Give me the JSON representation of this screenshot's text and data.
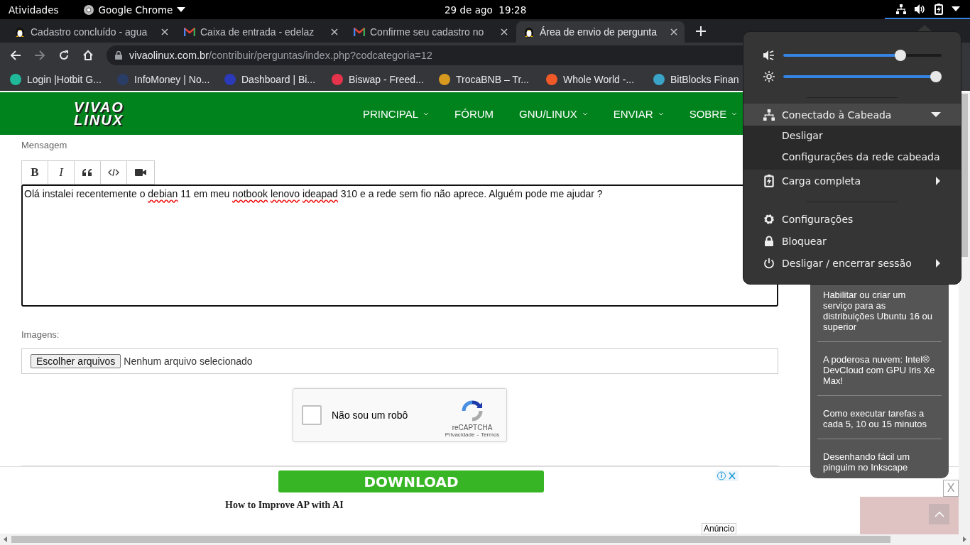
{
  "topbar": {
    "activities": "Atividades",
    "app": "Google Chrome",
    "date": "29 de ago",
    "time": "19:28"
  },
  "tabs": [
    {
      "title": "Cadastro concluído - agua",
      "kind": "penguin",
      "selected": false
    },
    {
      "title": "Caixa de entrada - edelaz",
      "kind": "mail",
      "selected": false
    },
    {
      "title": "Confirme seu cadastro no",
      "kind": "mail",
      "selected": false
    },
    {
      "title": "Área de envio de pergunta",
      "kind": "penguin",
      "selected": true
    }
  ],
  "address": {
    "domain": "vivaolinux.com.br",
    "path": "/contribuir/perguntas/index.php?codcategoria=12"
  },
  "bookmarks": [
    {
      "label": "Login |Hotbit G...",
      "color": "#1fb99a"
    },
    {
      "label": "InfoMoney | No...",
      "color": "#2a3d66"
    },
    {
      "label": "Dashboard | Bi...",
      "color": "#2b3ab8"
    },
    {
      "label": "Biswap - Freed...",
      "color": "#e4334a"
    },
    {
      "label": "TrocaBNB – Tr...",
      "color": "#d89a1e"
    },
    {
      "label": "Whole World -...",
      "color": "#f05a28"
    },
    {
      "label": "BitBlocks Finan",
      "color": "#3aa3c8"
    }
  ],
  "site": {
    "logo_top": "VIVAO",
    "logo_bottom": "LINUX",
    "nav": [
      {
        "label": "PRINCIPAL",
        "dropdown": true
      },
      {
        "label": "FÓRUM",
        "dropdown": false
      },
      {
        "label": "GNU/LINUX",
        "dropdown": true
      },
      {
        "label": "ENVIAR",
        "dropdown": true
      },
      {
        "label": "SOBRE",
        "dropdown": true
      }
    ]
  },
  "form": {
    "message_label": "Mensagem",
    "toolbar": [
      {
        "kind": "bold",
        "label": "B"
      },
      {
        "kind": "italic",
        "label": "I"
      },
      {
        "kind": "quote"
      },
      {
        "kind": "code"
      },
      {
        "kind": "video"
      }
    ],
    "message": [
      {
        "text": "Olá instalei recentemente o",
        "misspelled": false
      },
      {
        "text": "debian",
        "misspelled": true
      },
      {
        "text": "11 em meu",
        "misspelled": false
      },
      {
        "text": "notbook",
        "misspelled": true
      },
      {
        "text": "lenovo",
        "misspelled": true
      },
      {
        "text": "ideapad",
        "misspelled": true
      },
      {
        "text": "310 e a rede sem fio não aprece. Alguém pode me ajudar ?",
        "misspelled": false
      }
    ],
    "images_label": "Imagens:",
    "file_button": "Escolher arquivos",
    "file_status": "Nenhum arquivo selecionado",
    "captcha": {
      "label": "Não sou um robô",
      "checked": false,
      "brand": "reCAPTCHA",
      "privacy": "Privacidade",
      "separator": "-",
      "terms": "Termos"
    }
  },
  "sidebar": {
    "items": [
      "Habilitar ou criar um serviço para as distribuições Ubuntu 16 ou superior",
      "A poderosa nuvem: Intel® DevCloud com GPU Iris Xe Max!",
      "Como executar tarefas a cada 5, 10 ou 15 minutos",
      "Desenhando fácil um pinguim no Inkscape"
    ],
    "close": "X"
  },
  "ad": {
    "button": "DOWNLOAD",
    "headline": "How to Improve AP with AI",
    "badge": "Anúncio"
  },
  "menu": {
    "volume": {
      "level": 0.76
    },
    "brightness": {
      "level": 1.0
    },
    "network": {
      "label": "Conectado à Cabeada",
      "expanded": true,
      "items": [
        "Desligar",
        "Configurações da rede cabeada"
      ]
    },
    "entries": [
      {
        "kind": "battery",
        "label": "Carga completa",
        "submenu": true
      },
      {
        "kind": "separator"
      },
      {
        "kind": "settings",
        "label": "Configurações",
        "submenu": false
      },
      {
        "kind": "lock",
        "label": "Bloquear",
        "submenu": false
      },
      {
        "kind": "power",
        "label": "Desligar / encerrar sessão",
        "submenu": true
      }
    ]
  }
}
